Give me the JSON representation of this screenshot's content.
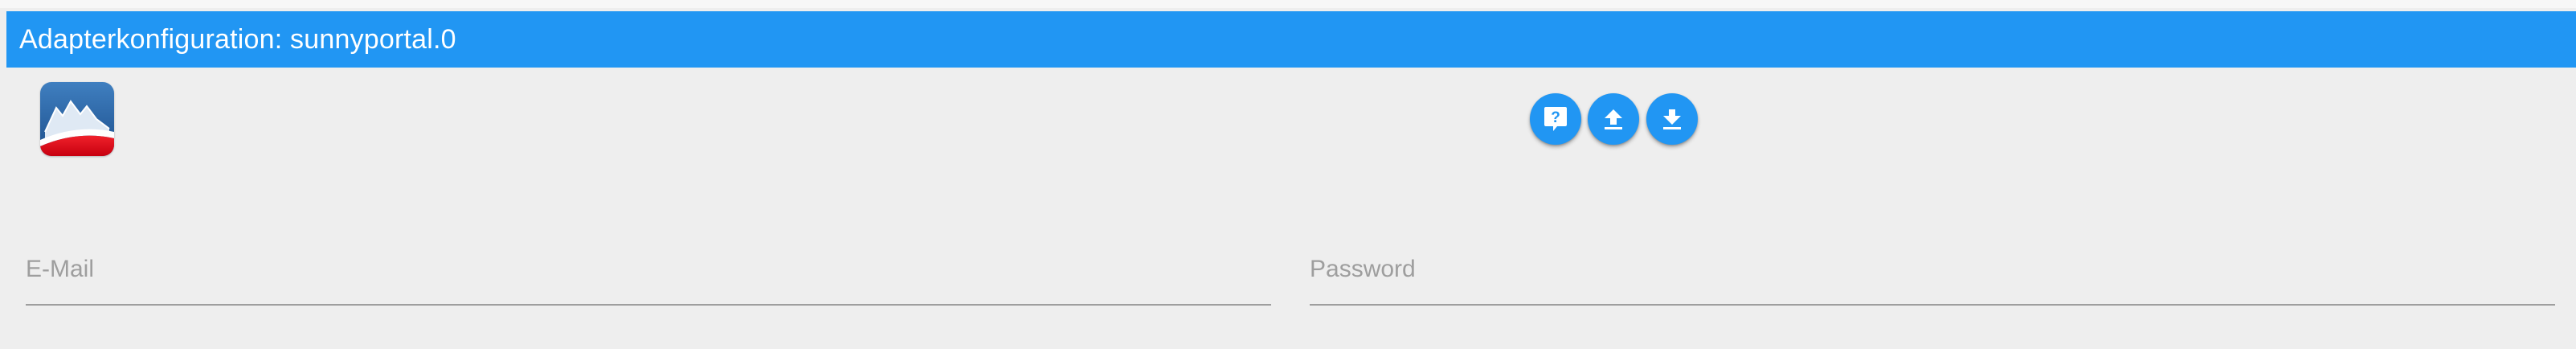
{
  "window": {
    "title": "Adapterkonfiguration: sunnyportal.0"
  },
  "logo": {
    "icon": "sunnyportal-mountain-logo-icon"
  },
  "toolbar": {
    "help_icon": "help-question-icon",
    "upload_icon": "upload-icon",
    "download_icon": "download-icon"
  },
  "form": {
    "email": {
      "placeholder": "E-Mail",
      "value": ""
    },
    "password": {
      "placeholder": "Password",
      "value": ""
    }
  },
  "colors": {
    "accent": "#2196f3",
    "background": "#eeeeee",
    "logo_red": "#e30613",
    "logo_blue": "#1f5fa0"
  }
}
